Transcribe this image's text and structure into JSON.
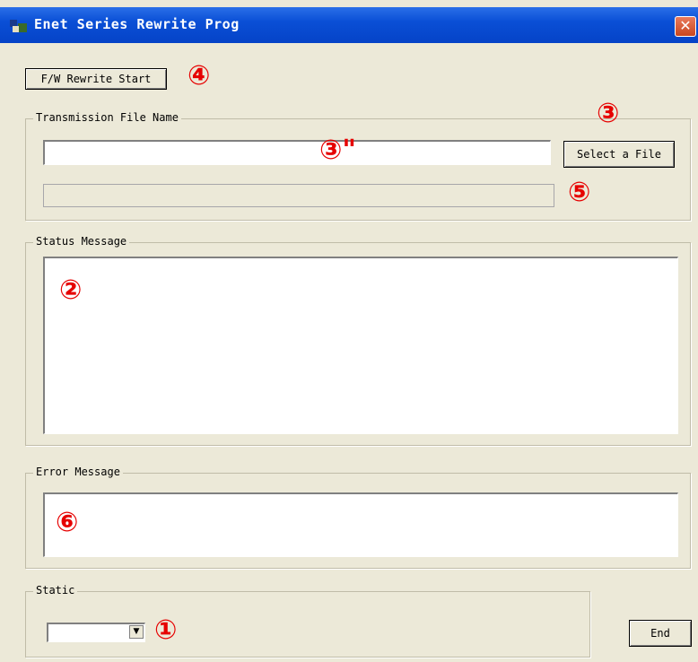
{
  "window": {
    "title": "Enet Series Rewrite Prog",
    "close_glyph": "✕",
    "icon": "app-icon"
  },
  "toolbar": {
    "rewrite_label": "F/W Rewrite Start"
  },
  "transmission": {
    "group_label": "Transmission File Name",
    "file_value": "",
    "select_label": "Select a File",
    "progress": 0
  },
  "status": {
    "group_label": "Status Message",
    "text": ""
  },
  "error": {
    "group_label": "Error Message",
    "text": ""
  },
  "static_group": {
    "group_label": "Static",
    "selected": "",
    "arrow_glyph": "▼"
  },
  "footer": {
    "end_label": "End"
  },
  "annotations": {
    "m1": "①",
    "m2": "②",
    "m3": "③",
    "m3b": "③\"",
    "m4": "④",
    "m5": "⑤",
    "m6": "⑥"
  },
  "colors": {
    "titlebar": "#0a4fd6",
    "face": "#ece9d8",
    "marker": "#e60000",
    "close": "#c9461f"
  }
}
